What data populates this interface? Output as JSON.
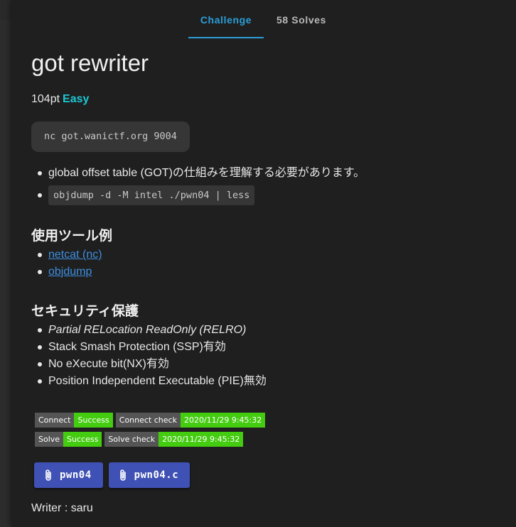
{
  "tabs": [
    {
      "label": "Challenge"
    },
    {
      "label": "58 Solves"
    }
  ],
  "challenge": {
    "title": "got rewriter",
    "points": "104pt",
    "difficulty": "Easy",
    "connect_command": "nc got.wanictf.org 9004",
    "notes": [
      "global offset table (GOT)の仕組みを理解する必要があります。",
      "objdump -d -M intel ./pwn04 | less"
    ],
    "tools_heading": "使用ツール例",
    "tools": [
      "netcat (nc)",
      "objdump"
    ],
    "security_heading": "セキュリティ保護",
    "security": [
      "Partial RELocation ReadOnly (RELRO)",
      "Stack Smash Protection (SSP)有効",
      "No eXecute bit(NX)有効",
      "Position Independent Executable (PIE)無効"
    ],
    "badges": {
      "connect": {
        "label": "Connect",
        "value": "Success"
      },
      "connect_check": {
        "label": "Connect check",
        "value": "2020/11/29 9:45:32"
      },
      "solve": {
        "label": "Solve",
        "value": "Success"
      },
      "solve_check": {
        "label": "Solve check",
        "value": "2020/11/29 9:45:32"
      }
    },
    "files": [
      "pwn04",
      "pwn04.c"
    ],
    "writer": "Writer : saru"
  },
  "colors": {
    "accent": "#2b9fd9",
    "difficulty_easy": "#1cc8d4",
    "badge_success": "#44cc11",
    "file_button": "#3f51b5",
    "link": "#3d8fe0"
  },
  "icons": {
    "file_button": "paperclip-icon"
  }
}
